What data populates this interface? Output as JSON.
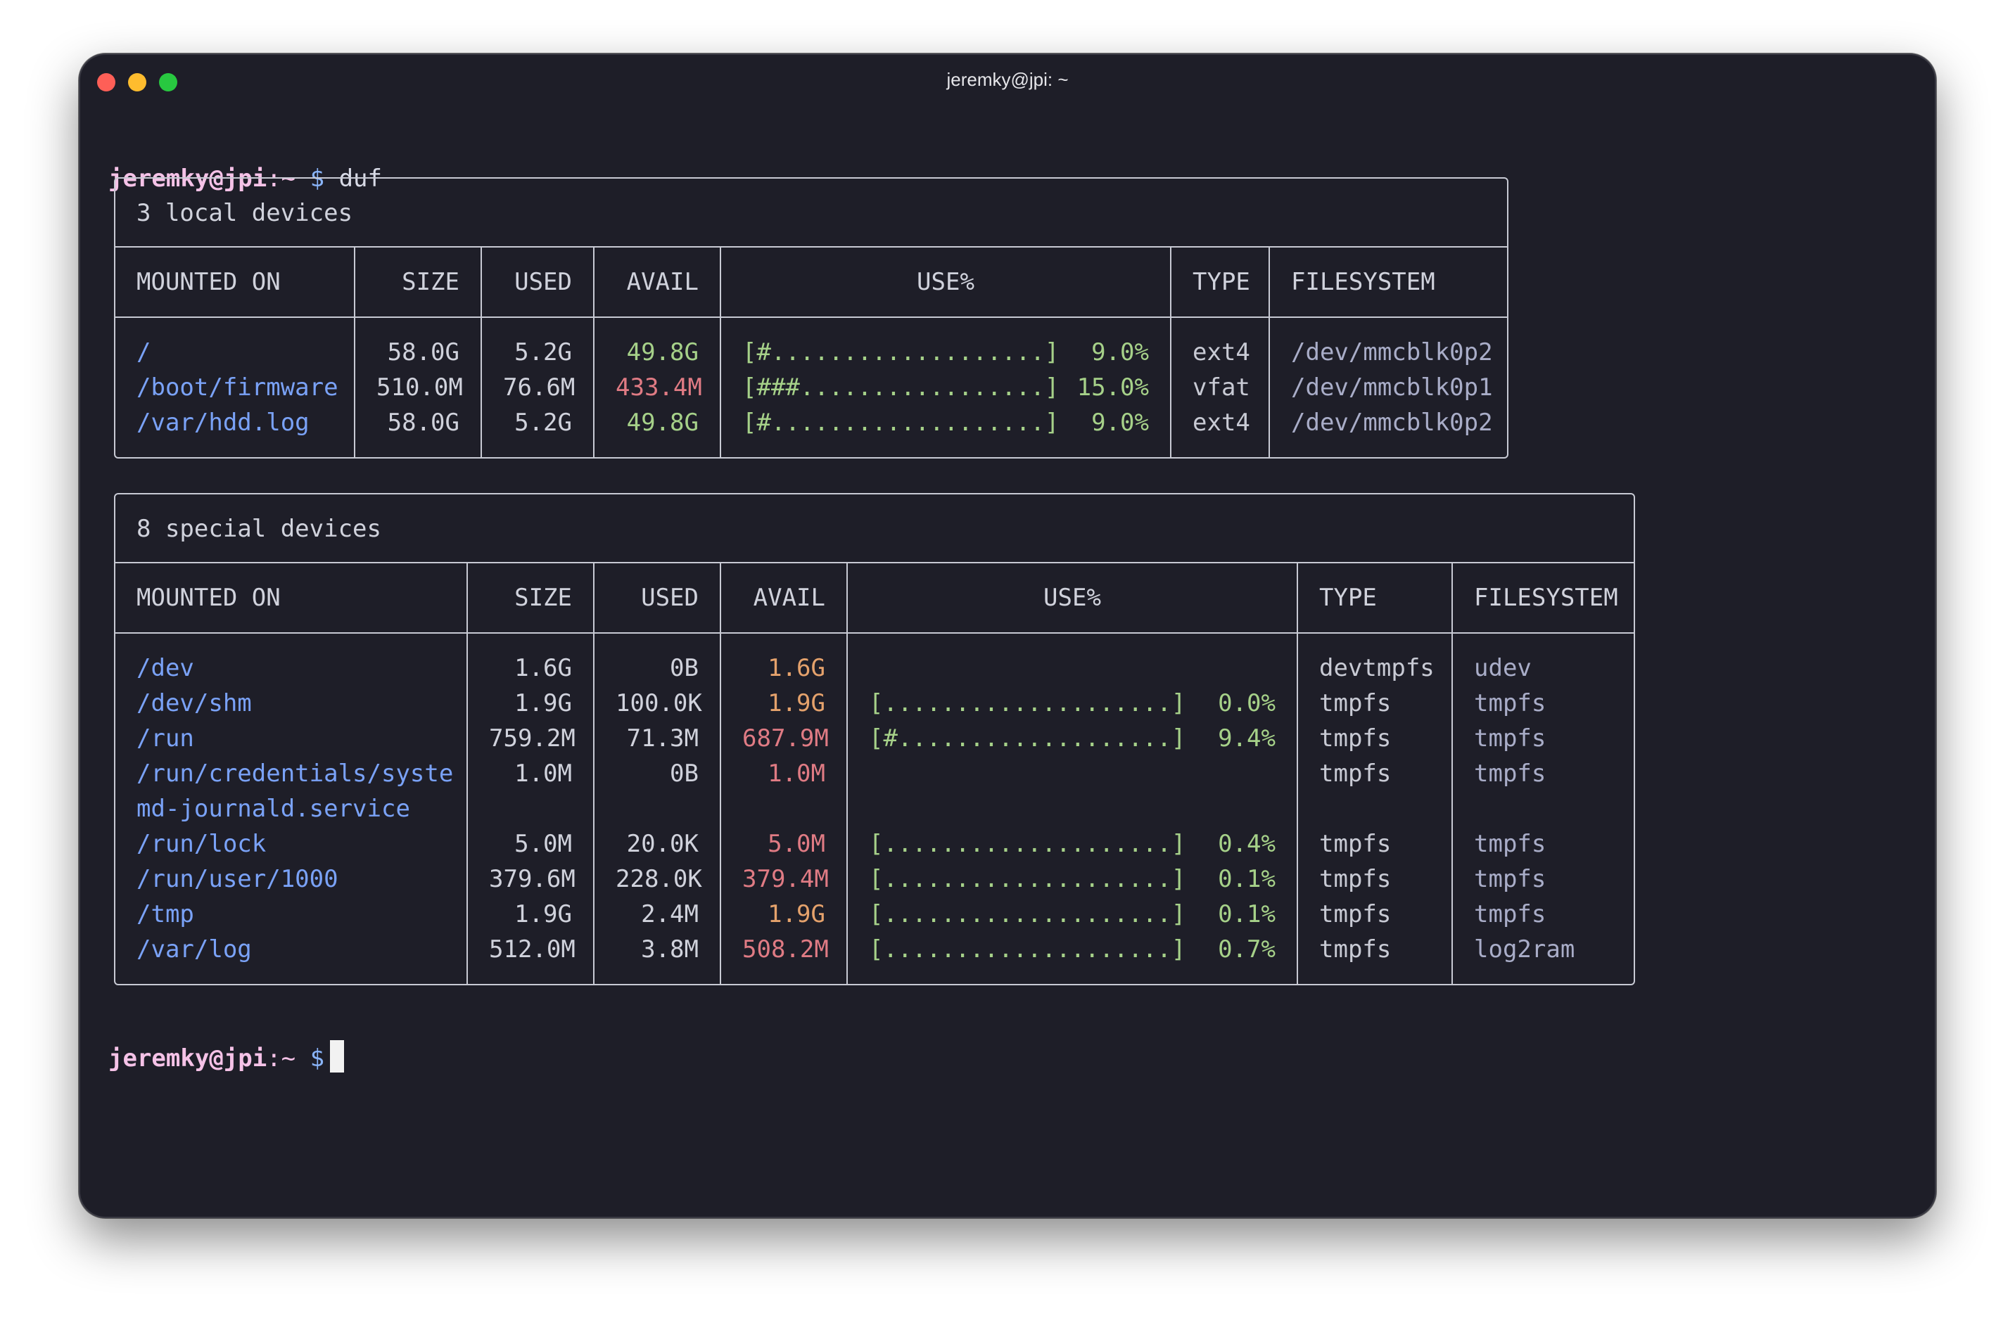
{
  "window": {
    "title": "jeremky@jpi: ~"
  },
  "prompt": {
    "user_host": "jeremky@jpi",
    "path": ":~",
    "dollar": "$",
    "command": "duf"
  },
  "colors": {
    "mount": "#7aa2f7",
    "avail_ok": "#a6d189",
    "avail_warn": "#e5a26c",
    "avail_low": "#e07b84",
    "bar": "#a6d189",
    "background": "#1e1e28"
  },
  "local": {
    "title": "3 local devices",
    "headers": [
      "MOUNTED ON",
      "SIZE",
      "USED",
      "AVAIL",
      "USE%",
      "TYPE",
      "FILESYSTEM"
    ],
    "rows": [
      {
        "mount": "/",
        "size": "58.0G",
        "used": "5.2G",
        "avail": "49.8G",
        "avail_color": "green",
        "bar": "[#...................]",
        "pct": "9.0%",
        "type": "ext4",
        "fs": "/dev/mmcblk0p2"
      },
      {
        "mount": "/boot/firmware",
        "size": "510.0M",
        "used": "76.6M",
        "avail": "433.4M",
        "avail_color": "red",
        "bar": "[###.................]",
        "pct": "15.0%",
        "type": "vfat",
        "fs": "/dev/mmcblk0p1"
      },
      {
        "mount": "/var/hdd.log",
        "size": "58.0G",
        "used": "5.2G",
        "avail": "49.8G",
        "avail_color": "green",
        "bar": "[#...................]",
        "pct": "9.0%",
        "type": "ext4",
        "fs": "/dev/mmcblk0p2"
      }
    ]
  },
  "special": {
    "title": "8 special devices",
    "headers": [
      "MOUNTED ON",
      "SIZE",
      "USED",
      "AVAIL",
      "USE%",
      "TYPE",
      "FILESYSTEM"
    ],
    "rows": [
      {
        "mount": "/dev",
        "size": "1.6G",
        "used": "0B",
        "avail": "1.6G",
        "avail_color": "orange",
        "bar": "",
        "pct": "",
        "type": "devtmpfs",
        "fs": "udev"
      },
      {
        "mount": "/dev/shm",
        "size": "1.9G",
        "used": "100.0K",
        "avail": "1.9G",
        "avail_color": "orange",
        "bar": "[....................]",
        "pct": "0.0%",
        "type": "tmpfs",
        "fs": "tmpfs"
      },
      {
        "mount": "/run",
        "size": "759.2M",
        "used": "71.3M",
        "avail": "687.9M",
        "avail_color": "red",
        "bar": "[#...................]",
        "pct": "9.4%",
        "type": "tmpfs",
        "fs": "tmpfs"
      },
      {
        "mount": "/run/credentials/syste",
        "size": "1.0M",
        "used": "0B",
        "avail": "1.0M",
        "avail_color": "red",
        "bar": "",
        "pct": "",
        "type": "tmpfs",
        "fs": "tmpfs"
      },
      {
        "mount": "md-journald.service",
        "size": "",
        "used": "",
        "avail": "",
        "avail_color": "red",
        "bar": "",
        "pct": "",
        "type": "",
        "fs": ""
      },
      {
        "mount": "/run/lock",
        "size": "5.0M",
        "used": "20.0K",
        "avail": "5.0M",
        "avail_color": "red",
        "bar": "[....................]",
        "pct": "0.4%",
        "type": "tmpfs",
        "fs": "tmpfs"
      },
      {
        "mount": "/run/user/1000",
        "size": "379.6M",
        "used": "228.0K",
        "avail": "379.4M",
        "avail_color": "red",
        "bar": "[....................]",
        "pct": "0.1%",
        "type": "tmpfs",
        "fs": "tmpfs"
      },
      {
        "mount": "/tmp",
        "size": "1.9G",
        "used": "2.4M",
        "avail": "1.9G",
        "avail_color": "orange",
        "bar": "[....................]",
        "pct": "0.1%",
        "type": "tmpfs",
        "fs": "tmpfs"
      },
      {
        "mount": "/var/log",
        "size": "512.0M",
        "used": "3.8M",
        "avail": "508.2M",
        "avail_color": "red",
        "bar": "[....................]",
        "pct": "0.7%",
        "type": "tmpfs",
        "fs": "log2ram"
      }
    ]
  }
}
